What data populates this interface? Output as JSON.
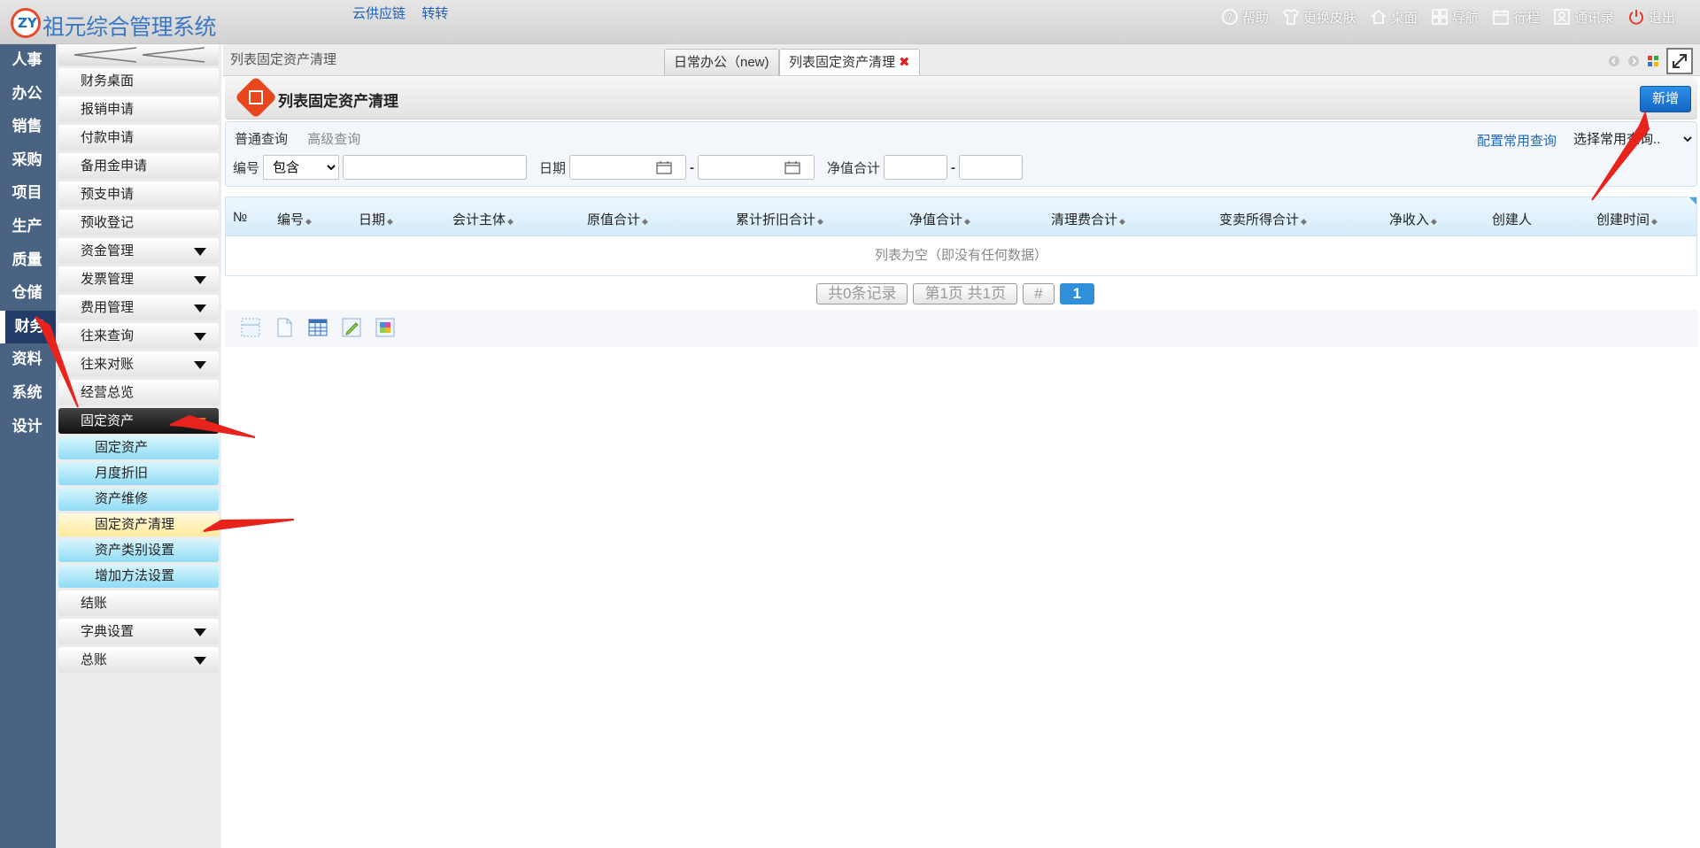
{
  "app": {
    "logo_text": "ZY",
    "title": "祖元综合管理系统",
    "top_links": [
      "云供应链",
      "转转"
    ],
    "toolbar": [
      {
        "label": "帮助",
        "icon": "help-icon"
      },
      {
        "label": "更换皮肤",
        "icon": "shirt-icon"
      },
      {
        "label": "桌面",
        "icon": "home-icon"
      },
      {
        "label": "导航",
        "icon": "grid-icon"
      },
      {
        "label": "行程",
        "icon": "calendar-icon"
      },
      {
        "label": "通讯录",
        "icon": "contacts-icon"
      },
      {
        "label": "退出",
        "icon": "power-icon"
      }
    ]
  },
  "modules": [
    "人事",
    "办公",
    "销售",
    "采购",
    "项目",
    "生产",
    "质量",
    "仓储",
    "财务",
    "资料",
    "系统",
    "设计"
  ],
  "active_module": "财务",
  "menu": {
    "items": [
      {
        "label": "财务桌面"
      },
      {
        "label": "报销申请"
      },
      {
        "label": "付款申请"
      },
      {
        "label": "备用金申请"
      },
      {
        "label": "预支申请"
      },
      {
        "label": "预收登记"
      },
      {
        "label": "资金管理"
      },
      {
        "label": "发票管理"
      },
      {
        "label": "费用管理"
      },
      {
        "label": "往来查询"
      },
      {
        "label": "往来对账"
      },
      {
        "label": "经营总览"
      },
      {
        "label": "固定资产"
      }
    ],
    "fixed_assets_children": [
      "固定资产",
      "月度折旧",
      "资产维修",
      "固定资产清理",
      "资产类别设置",
      "增加方法设置"
    ],
    "after": [
      "结账",
      "字典设置",
      "总账"
    ]
  },
  "tabs": {
    "breadcrumb": "列表固定资产清理",
    "tab1": "日常办公（new)",
    "tab2": "列表固定资产清理",
    "close": "✖"
  },
  "page": {
    "title": "列表固定资产清理",
    "new_button": "新增"
  },
  "search": {
    "tab_normal": "普通查询",
    "tab_advanced": "高级查询",
    "config_link": "配置常用查询",
    "common_select": "选择常用查询..",
    "code_label": "编号",
    "code_op": "包含",
    "date_label": "日期",
    "net_label": "净值合计",
    "dash": "-"
  },
  "grid": {
    "columns": [
      "№",
      "编号",
      "日期",
      "会计主体",
      "原值合计",
      "累计折旧合计",
      "净值合计",
      "清理费合计",
      "变卖所得合计",
      "净收入",
      "创建人",
      "创建时间"
    ],
    "empty_text": "列表为空（即没有任何数据）"
  },
  "pager": {
    "records": "共0条记录",
    "pages": "第1页 共1页",
    "hash": "#",
    "current": "1"
  },
  "bottom_icons": [
    "select-icon",
    "page-icon",
    "table-icon",
    "edit-icon",
    "puzzle-icon"
  ],
  "colors": {
    "module_bar": "#4a6383",
    "accent_blue": "#1466c3",
    "dark_menu": "#111111",
    "arrow_red": "#e8231c"
  }
}
